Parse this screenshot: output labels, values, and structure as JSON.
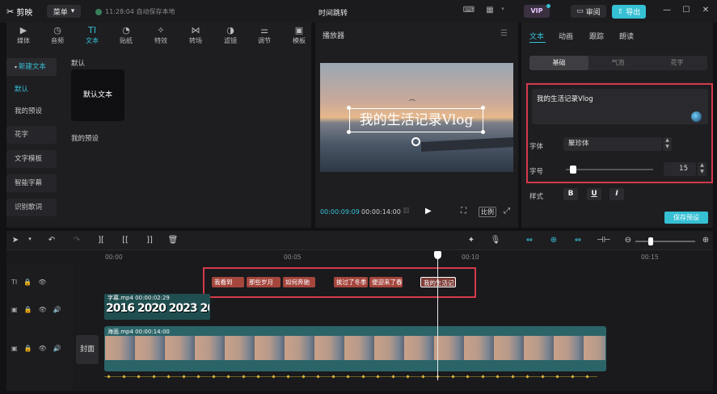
{
  "app": {
    "name": "剪映",
    "title": "时间跳转",
    "save_status": "11:28:04 自动保存本地",
    "menu_label": "菜单",
    "vip_label": "VIP",
    "review_label": "审阅",
    "export_label": "导出"
  },
  "categories": [
    "媒体",
    "音频",
    "文本",
    "贴纸",
    "特效",
    "转场",
    "滤镜",
    "调节",
    "模板"
  ],
  "active_category": "文本",
  "sidebar": {
    "new_text": "新建文本",
    "items": [
      "默认",
      "我的预设",
      "花字",
      "文字模板",
      "智能字幕",
      "识别歌词"
    ]
  },
  "presets": {
    "section_default": "默认",
    "card_label": "默认文本",
    "section_mine": "我的预设"
  },
  "player": {
    "title": "播放器",
    "overlay_text": "我的生活记录Vlog",
    "time_current": "00:00:09:09",
    "time_total": "00:00:14:00",
    "ratio_label": "比例"
  },
  "right": {
    "tabs": [
      "文本",
      "动画",
      "跟踪",
      "朗读"
    ],
    "subtabs": [
      "基础",
      "气泡",
      "花字"
    ],
    "text_value": "我的生活记录Vlog",
    "font_label": "字体",
    "font_value": "聚珍体",
    "size_label": "字号",
    "size_value": "15",
    "size_fraction": 0.05,
    "style_label": "样式",
    "style_buttons": [
      "B",
      "U",
      "I"
    ],
    "save_preset": "保存预设"
  },
  "timeline": {
    "ruler": [
      "00:00",
      "00:05",
      "00:10",
      "00:15"
    ],
    "text_clips": [
      "我看到",
      "那些岁月",
      "如何奔驰",
      "挨过了冬季",
      "便迎来了春",
      "我的生活记"
    ],
    "subtitle_clip": {
      "title": "字幕.mp4 00:00:02:29",
      "years": "2016 2020 2023 20"
    },
    "main_clip": {
      "title": "海面.mp4 00:00:14:00"
    },
    "cover_label": "封面"
  }
}
